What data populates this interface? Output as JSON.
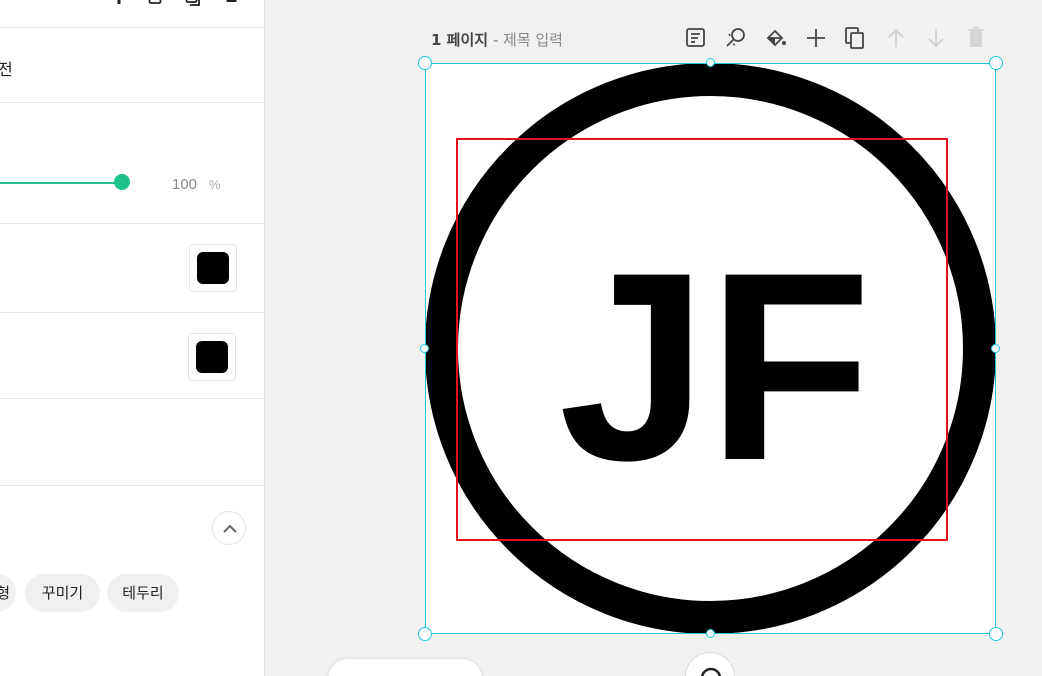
{
  "sidebar": {
    "rotation_label": "전",
    "opacity": {
      "value": "100",
      "unit": "%",
      "level_percent": 100
    },
    "colors": {
      "fill": "#000000",
      "stroke": "#000000",
      "accent": "#1fc18c"
    },
    "chips": [
      {
        "label": "형"
      },
      {
        "label": "꾸미기"
      },
      {
        "label": "테두리"
      }
    ]
  },
  "page": {
    "number": "1 페이지",
    "separator": " - ",
    "title_placeholder": "제목 입력",
    "toolbar": [
      {
        "icon": "note-icon"
      },
      {
        "icon": "magic-search-icon"
      },
      {
        "icon": "paint-bucket-icon"
      },
      {
        "icon": "add-icon"
      },
      {
        "icon": "duplicate-icon"
      },
      {
        "icon": "arrow-up-icon",
        "disabled": true
      },
      {
        "icon": "arrow-down-icon",
        "disabled": true
      },
      {
        "icon": "trash-icon",
        "disabled": true
      }
    ]
  },
  "design": {
    "logo_text": "JF",
    "selection_color": "#1ec8df",
    "frame_color": "#e4101a"
  }
}
